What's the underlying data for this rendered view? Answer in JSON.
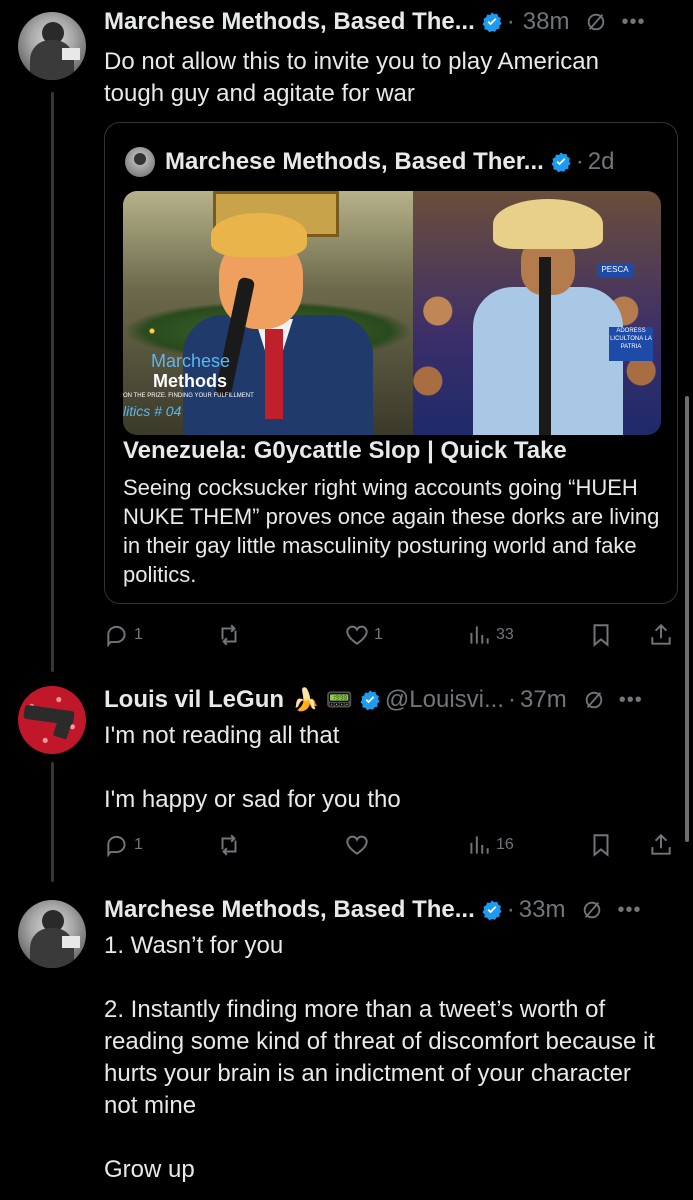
{
  "colors": {
    "background": "#000000",
    "text": "#e7e9ea",
    "muted": "#71767b",
    "verified": "#1d9bf0",
    "border": "#2f3336"
  },
  "posts": [
    {
      "author_name": "Marchese Methods, Based The...",
      "time": "38m",
      "text": "Do not allow this to invite you to play American tough guy and agitate for war",
      "quote": {
        "author_name": "Marchese Methods, Based Ther...",
        "time": "2d",
        "image_logo_line1": "Marchese",
        "image_logo_line2": "Methods",
        "image_logo_tagline": "ON THE PRIZE. FINDING YOUR FULFILLMENT",
        "image_logo_series": "litics # 04",
        "image_sign_left": "PESCA",
        "image_sign_right": "ADORESS LICULTONA LA PATRIA",
        "title": "Venezuela: G0ycattle Slop | Quick Take",
        "text": "Seeing cocksucker right wing accounts going “HUEH NUKE THEM” proves once again these dorks are living in their gay little masculinity posturing world and fake politics."
      },
      "replies": "1",
      "reposts": "",
      "likes": "1",
      "views": "33"
    },
    {
      "author_name": "Louis vil LeGun",
      "name_emoji": "🍌 📟",
      "handle": "@Louisvi...",
      "time": "37m",
      "text": "I'm not reading all that\n\nI'm happy or sad for you tho",
      "replies": "1",
      "reposts": "",
      "likes": "",
      "views": "16"
    },
    {
      "author_name": "Marchese Methods, Based The...",
      "time": "33m",
      "text": "1. Wasn’t for you\n\n2. Instantly finding more than a tweet’s worth of reading some kind of threat of discomfort because it hurts your brain is an indictment of your character not mine\n\nGrow up"
    }
  ]
}
